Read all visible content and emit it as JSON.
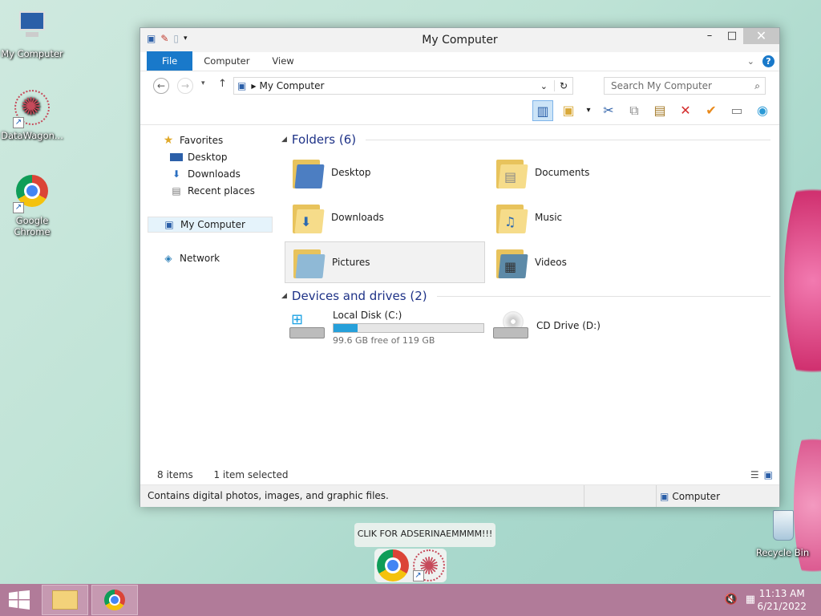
{
  "desktop": {
    "icons": [
      {
        "label": "My Computer"
      },
      {
        "label": "DataWagon..."
      },
      {
        "label": "Google Chrome"
      }
    ],
    "recycle_bin": "Recycle Bin",
    "banner": "CLIK FOR ADSERINAEMMMM!!!"
  },
  "window": {
    "title": "My Computer",
    "tabs": [
      "File",
      "Computer",
      "View"
    ],
    "address": "My Computer",
    "search_placeholder": "Search My Computer"
  },
  "nav": {
    "favorites": "Favorites",
    "desktop": "Desktop",
    "downloads": "Downloads",
    "recent": "Recent places",
    "my_computer": "My Computer",
    "network": "Network"
  },
  "content": {
    "folders_header": "Folders (6)",
    "folders": [
      "Desktop",
      "Documents",
      "Downloads",
      "Music",
      "Pictures",
      "Videos"
    ],
    "drives_header": "Devices and drives (2)",
    "drives": [
      {
        "name": "Local Disk (C:)",
        "free": "99.6 GB free of 119 GB",
        "used_fraction": 0.163
      },
      {
        "name": "CD Drive (D:)"
      }
    ]
  },
  "status": {
    "items": "8 items",
    "selected": "1 item selected",
    "description": "Contains digital photos, images, and graphic files.",
    "location": "Computer"
  },
  "taskbar": {
    "time": "11:13 AM",
    "date": "6/21/2022"
  },
  "colors": {
    "accent": "#1979ca",
    "taskbar": "#b17b99"
  }
}
